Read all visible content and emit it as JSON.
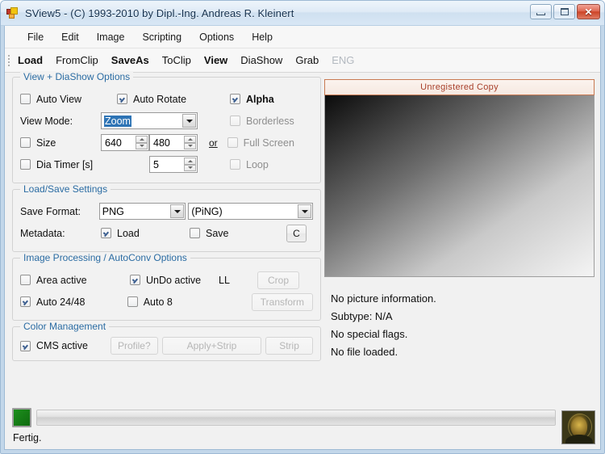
{
  "window": {
    "title": "SView5 - (C) 1993-2010 by Dipl.-Ing. Andreas R. Kleinert",
    "minimize_label": "",
    "maximize_label": "",
    "close_label": "✕"
  },
  "menubar": {
    "items": [
      {
        "label": "File"
      },
      {
        "label": "Edit"
      },
      {
        "label": "Image"
      },
      {
        "label": "Scripting"
      },
      {
        "label": "Options"
      },
      {
        "label": "Help"
      }
    ]
  },
  "toolbar": {
    "items": [
      {
        "label": "Load",
        "bold": true,
        "disabled": false
      },
      {
        "label": "FromClip",
        "bold": false,
        "disabled": false
      },
      {
        "label": "SaveAs",
        "bold": true,
        "disabled": false
      },
      {
        "label": "ToClip",
        "bold": false,
        "disabled": false
      },
      {
        "label": "View",
        "bold": true,
        "disabled": false
      },
      {
        "label": "DiaShow",
        "bold": false,
        "disabled": false
      },
      {
        "label": "Grab",
        "bold": false,
        "disabled": false
      },
      {
        "label": "ENG",
        "bold": false,
        "disabled": true
      }
    ]
  },
  "view_diashow": {
    "title": "View + DiaShow Options",
    "auto_view": {
      "label": "Auto View",
      "checked": false
    },
    "auto_rotate": {
      "label": "Auto Rotate",
      "checked": true
    },
    "alpha": {
      "label": "Alpha",
      "checked": true
    },
    "view_mode_label": "View Mode:",
    "view_mode_value": "Zoom",
    "borderless": {
      "label": "Borderless",
      "checked": false
    },
    "size": {
      "label": "Size",
      "checked": false
    },
    "size_width": "640",
    "size_height": "480",
    "or_label": "or",
    "full_screen": {
      "label": "Full Screen",
      "checked": false
    },
    "dia_timer": {
      "label": "Dia Timer [s]",
      "checked": false
    },
    "dia_timer_value": "5",
    "loop": {
      "label": "Loop",
      "checked": false
    }
  },
  "load_save": {
    "title": "Load/Save Settings",
    "save_format_label": "Save Format:",
    "save_format_value": "PNG",
    "save_format_desc": "(PiNG)",
    "metadata_label": "Metadata:",
    "metadata_load": {
      "label": "Load",
      "checked": true
    },
    "metadata_save": {
      "label": "Save",
      "checked": false
    },
    "c_button": "C"
  },
  "image_processing": {
    "title": "Image Processing / AutoConv Options",
    "area_active": {
      "label": "Area active",
      "checked": false
    },
    "undo_active": {
      "label": "UnDo active",
      "checked": true
    },
    "ll_label": "LL",
    "crop_button": "Crop",
    "auto_2448": {
      "label": "Auto 24/48",
      "checked": true
    },
    "auto_8": {
      "label": "Auto 8",
      "checked": false
    },
    "transform_button": "Transform"
  },
  "color_management": {
    "title": "Color Management",
    "cms_active": {
      "label": "CMS active",
      "checked": true
    },
    "profile_button": "Profile?",
    "apply_strip_button": "Apply+Strip",
    "strip_button": "Strip"
  },
  "preview": {
    "banner_text": "Unregistered Copy"
  },
  "info": {
    "lines": [
      "No picture information.",
      "Subtype: N/A",
      "No special flags.",
      "No file loaded."
    ]
  },
  "status": {
    "text": "Fertig."
  },
  "colors": {
    "group_title": "#2b6ca3",
    "banner_text": "#a8402b",
    "banner_border": "#c97a52",
    "selection": "#2e74b5",
    "indicator_green": "#1d8f1d"
  }
}
